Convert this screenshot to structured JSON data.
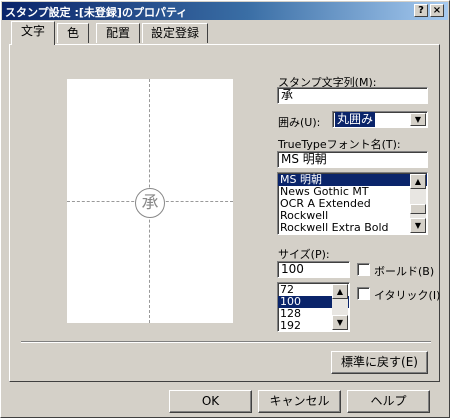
{
  "window": {
    "title": "スタンプ設定 :[未登録]のプロパティ"
  },
  "titlebar_buttons": {
    "help": "?",
    "close": "×"
  },
  "tabs": [
    {
      "label": "文字",
      "active": true
    },
    {
      "label": "色",
      "active": false
    },
    {
      "label": "配置",
      "active": false
    },
    {
      "label": "設定登録",
      "active": false
    }
  ],
  "preview": {
    "stamp_char": "承"
  },
  "text_section": {
    "label": "スタンプ文字列(M):",
    "value": "承"
  },
  "enclosure": {
    "label": "囲み(U):",
    "selected": "丸囲み"
  },
  "font": {
    "label": "TrueTypeフォント名(T):",
    "value": "MS 明朝",
    "options": [
      "MS 明朝",
      "News Gothic MT",
      "OCR A Extended",
      "Rockwell",
      "Rockwell Extra Bold"
    ],
    "selected_index": 0
  },
  "size": {
    "label": "サイズ(P):",
    "value": "100",
    "options": [
      "72",
      "100",
      "128",
      "192"
    ],
    "selected_index": 1
  },
  "checkboxes": {
    "bold": "ボールド(B)",
    "italic": "イタリック(I)"
  },
  "buttons": {
    "reset": "標準に戻す(E)",
    "ok": "OK",
    "cancel": "キャンセル",
    "help": "ヘルプ"
  },
  "colors": {
    "titlebar_start": "#0a246a",
    "face": "#d4d0c8",
    "selection": "#0a246a"
  }
}
